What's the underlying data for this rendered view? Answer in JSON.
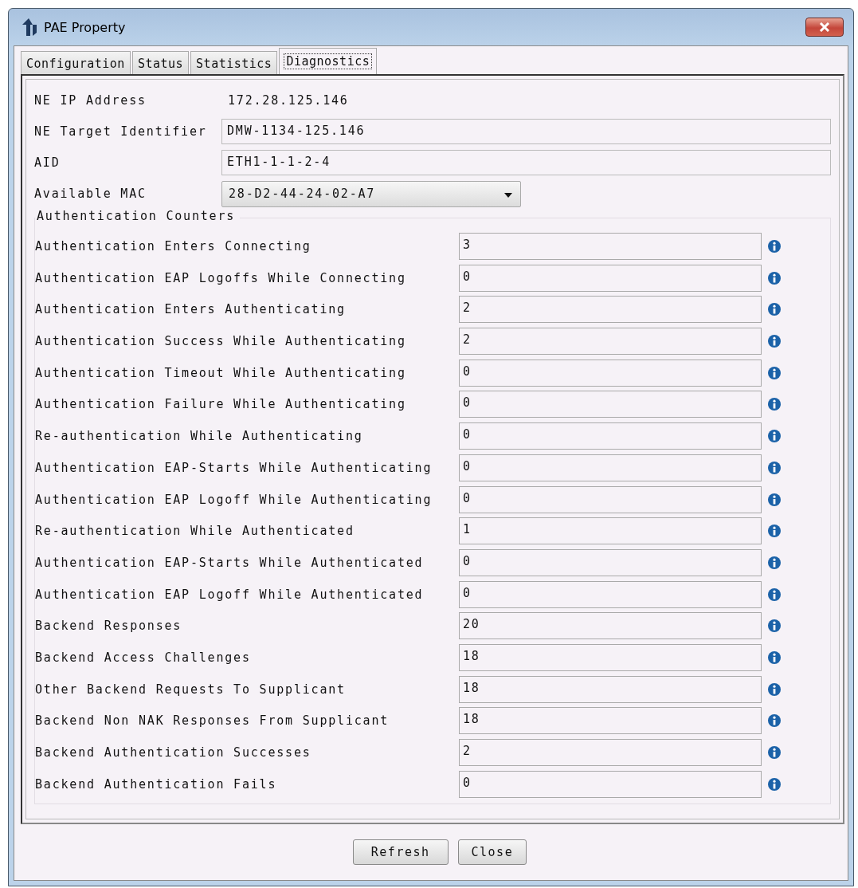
{
  "window": {
    "title": "PAE Property"
  },
  "tabs": [
    {
      "label": "Configuration",
      "selected": false
    },
    {
      "label": "Status",
      "selected": false
    },
    {
      "label": "Statistics",
      "selected": false
    },
    {
      "label": "Diagnostics",
      "selected": true
    }
  ],
  "ne_fields": [
    {
      "kind": "text",
      "label": "NE IP Address",
      "value": "172.28.125.146"
    },
    {
      "kind": "field",
      "label": "NE Target Identifier",
      "value": "DMW-1134-125.146"
    },
    {
      "kind": "field",
      "label": "AID",
      "value": "ETH1-1-1-2-4"
    },
    {
      "kind": "dropdown",
      "label": "Available MAC",
      "value": "28-D2-44-24-02-A7"
    }
  ],
  "counters": {
    "title": "Authentication Counters",
    "rows": [
      {
        "label": "Authentication Enters Connecting",
        "value": "3"
      },
      {
        "label": "Authentication EAP Logoffs While Connecting",
        "value": "0"
      },
      {
        "label": "Authentication Enters Authenticating",
        "value": "2"
      },
      {
        "label": "Authentication Success While Authenticating",
        "value": "2"
      },
      {
        "label": "Authentication Timeout While Authenticating",
        "value": "0"
      },
      {
        "label": "Authentication Failure While Authenticating",
        "value": "0"
      },
      {
        "label": "Re-authentication While Authenticating",
        "value": "0"
      },
      {
        "label": "Authentication EAP-Starts While Authenticating",
        "value": "0"
      },
      {
        "label": "Authentication EAP Logoff While Authenticating",
        "value": "0"
      },
      {
        "label": "Re-authentication While Authenticated",
        "value": "1"
      },
      {
        "label": "Authentication EAP-Starts While Authenticated",
        "value": "0"
      },
      {
        "label": "Authentication EAP Logoff While Authenticated",
        "value": "0"
      },
      {
        "label": "Backend Responses",
        "value": "20"
      },
      {
        "label": "Backend Access Challenges",
        "value": "18"
      },
      {
        "label": "Other Backend Requests To Supplicant",
        "value": "18"
      },
      {
        "label": "Backend Non NAK Responses From Supplicant",
        "value": "18"
      },
      {
        "label": "Backend Authentication Successes",
        "value": "2"
      },
      {
        "label": "Backend Authentication Fails",
        "value": "0"
      }
    ]
  },
  "buttons": [
    "Refresh",
    "Close"
  ]
}
